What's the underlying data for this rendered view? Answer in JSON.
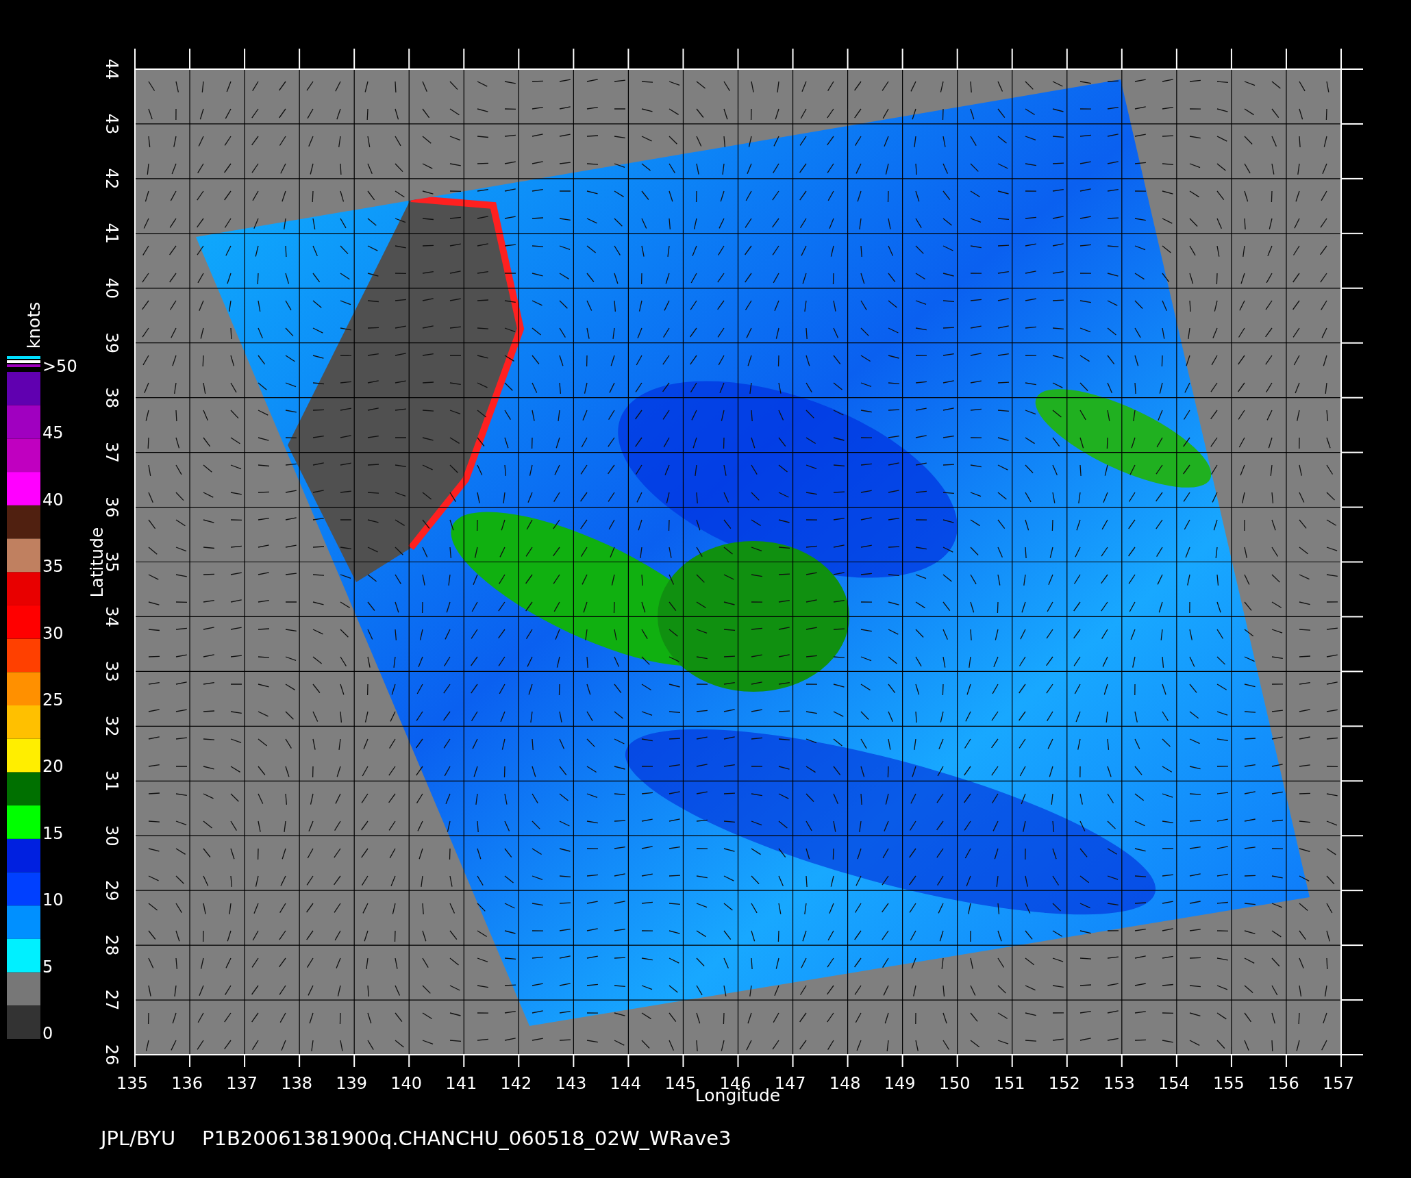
{
  "plot": {
    "x_axis": {
      "label": "Longitude",
      "ticks": [
        "135",
        "136",
        "137",
        "138",
        "139",
        "140",
        "141",
        "142",
        "143",
        "144",
        "145",
        "146",
        "147",
        "148",
        "149",
        "150",
        "151",
        "152",
        "153",
        "154",
        "155",
        "156",
        "157"
      ]
    },
    "y_axis": {
      "label": "Latitude",
      "ticks": [
        "26",
        "27",
        "28",
        "29",
        "30",
        "31",
        "32",
        "33",
        "34",
        "35",
        "36",
        "37",
        "38",
        "39",
        "40",
        "41",
        "42",
        "43",
        "44"
      ]
    }
  },
  "color_scale": {
    "title": "knots",
    "labels": [
      ">50",
      "45",
      "40",
      "35",
      "30",
      "25",
      "20",
      "15",
      "10",
      "5",
      "0"
    ]
  },
  "footer": {
    "credit": "JPL/BYU",
    "file": "P1B20061381900q.CHANCHU_060518_02W_WRave3"
  }
}
